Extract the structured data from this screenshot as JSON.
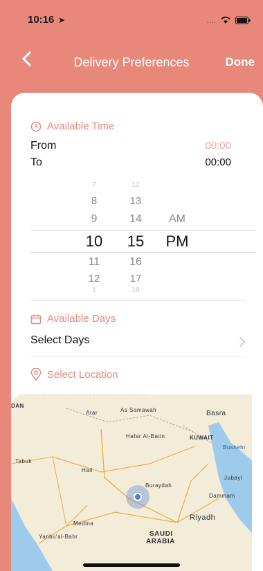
{
  "status_bar": {
    "time": "10:16",
    "signal": "....",
    "icons": [
      "location-arrow-icon",
      "wifi-icon",
      "battery-icon"
    ]
  },
  "nav": {
    "title": "Delivery Preferences",
    "done_label": "Done",
    "back_icon": "chevron-left-icon"
  },
  "available_time": {
    "title": "Available Time",
    "from_label": "From",
    "from_value": "00:00",
    "to_label": "To",
    "to_value": "00:00"
  },
  "picker": {
    "hours": [
      "7",
      "8",
      "9",
      "10",
      "11",
      "12",
      "1"
    ],
    "minutes": [
      "12",
      "13",
      "14",
      "15",
      "16",
      "17",
      "18"
    ],
    "period": [
      "AM",
      "PM"
    ],
    "selected": {
      "hour": "10",
      "minute": "15",
      "period": "PM"
    }
  },
  "available_days": {
    "title": "Available Days",
    "select_label": "Select Days"
  },
  "location": {
    "title": "Select Location",
    "map_labels": [
      "DAN",
      "Arar",
      "As Samawah",
      "Basra",
      "KUWAIT",
      "Bushehr",
      "Tabuk",
      "Hafar Al-Batin",
      "Hail",
      "Jubayl",
      "Buraydah",
      "Dammam",
      "Riyadh",
      "Medina",
      "Yanbu'al-Bahr",
      "SAUDI",
      "ARABIA"
    ]
  },
  "colors": {
    "accent": "#e8887a",
    "accent_text": "#e9897b",
    "selection_blue": "#4a7fd6"
  }
}
